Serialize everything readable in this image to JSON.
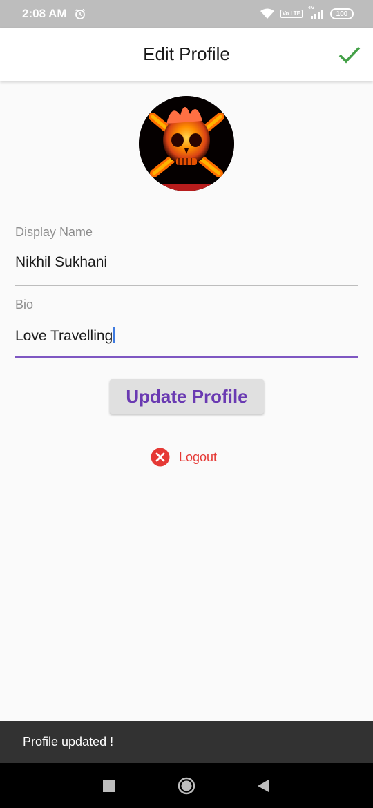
{
  "status_bar": {
    "time": "2:08 AM",
    "icons": [
      "alarm-icon",
      "wifi-icon",
      "volte-icon",
      "signal-icon",
      "battery-icon"
    ],
    "volte_label": "Vo LTE",
    "network_label": "4G",
    "battery": "100"
  },
  "app_bar": {
    "title": "Edit Profile",
    "save_icon": "check-icon"
  },
  "profile": {
    "avatar_icon": "flaming-skull-avatar"
  },
  "form": {
    "display_name": {
      "label": "Display Name",
      "value": "Nikhil Sukhani"
    },
    "bio": {
      "label": "Bio",
      "value": "Love Travelling"
    }
  },
  "actions": {
    "update_label": "Update Profile",
    "logout_label": "Logout",
    "logout_icon": "cancel-circle-icon"
  },
  "snackbar": {
    "message": "Profile updated !"
  },
  "navigation": {
    "buttons": [
      "recents-square-icon",
      "home-circle-icon",
      "back-triangle-icon"
    ]
  },
  "colors": {
    "accent": "#6a3ab2",
    "check": "#43a047",
    "logout": "#e53935",
    "focus_line": "#7e57c2"
  }
}
